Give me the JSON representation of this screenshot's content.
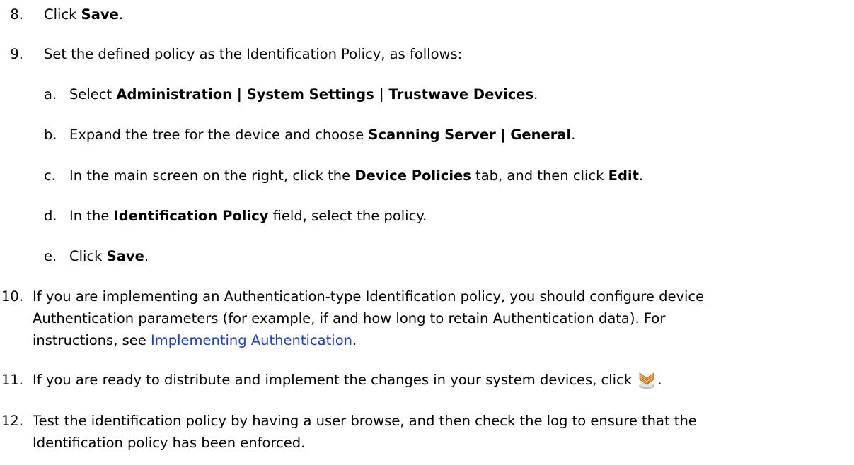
{
  "steps": [
    {
      "num": "8.",
      "pre": "Click ",
      "b1": "Save",
      "post": "."
    },
    {
      "num": "9.",
      "text": "Set the defined policy as the Identification Policy, as follows:"
    },
    {
      "num": "10.",
      "l1": "If you are implementing an Authentication-type Identification policy, you should configure device",
      "l2": "Authentication parameters (for example, if and how long to retain Authentication data). For",
      "l3_pre": "instructions, see ",
      "l3_link": "Implementing Authentication",
      "l3_post": "."
    },
    {
      "num": "11.",
      "text": "If you are ready to distribute and implement the changes in your system devices, click ",
      "post": ".",
      "icon": "distribute-icon"
    },
    {
      "num": "12.",
      "l1": "Test the identification policy by having a user browse, and then check the log to ensure that the",
      "l2": "Identification policy has been enforced."
    }
  ],
  "substeps": [
    {
      "num": "a.",
      "pre": "Select ",
      "b1": "Administration | System Settings | Trustwave Devices",
      "post": "."
    },
    {
      "num": "b.",
      "pre": "Expand the tree for the device and choose ",
      "b1": "Scanning Server | General",
      "post": "."
    },
    {
      "num": "c.",
      "pre": "In the main screen on the right, click the ",
      "b1": "Device Policies",
      "mid": " tab, and then click ",
      "b2": "Edit",
      "post": "."
    },
    {
      "num": "d.",
      "pre": "In the ",
      "b1": "Identification Policy",
      "post": " field, select the policy."
    },
    {
      "num": "e.",
      "pre": "Click ",
      "b1": "Save",
      "post": "."
    }
  ],
  "colors": {
    "link": "#1a3fd1",
    "text": "#000000"
  }
}
